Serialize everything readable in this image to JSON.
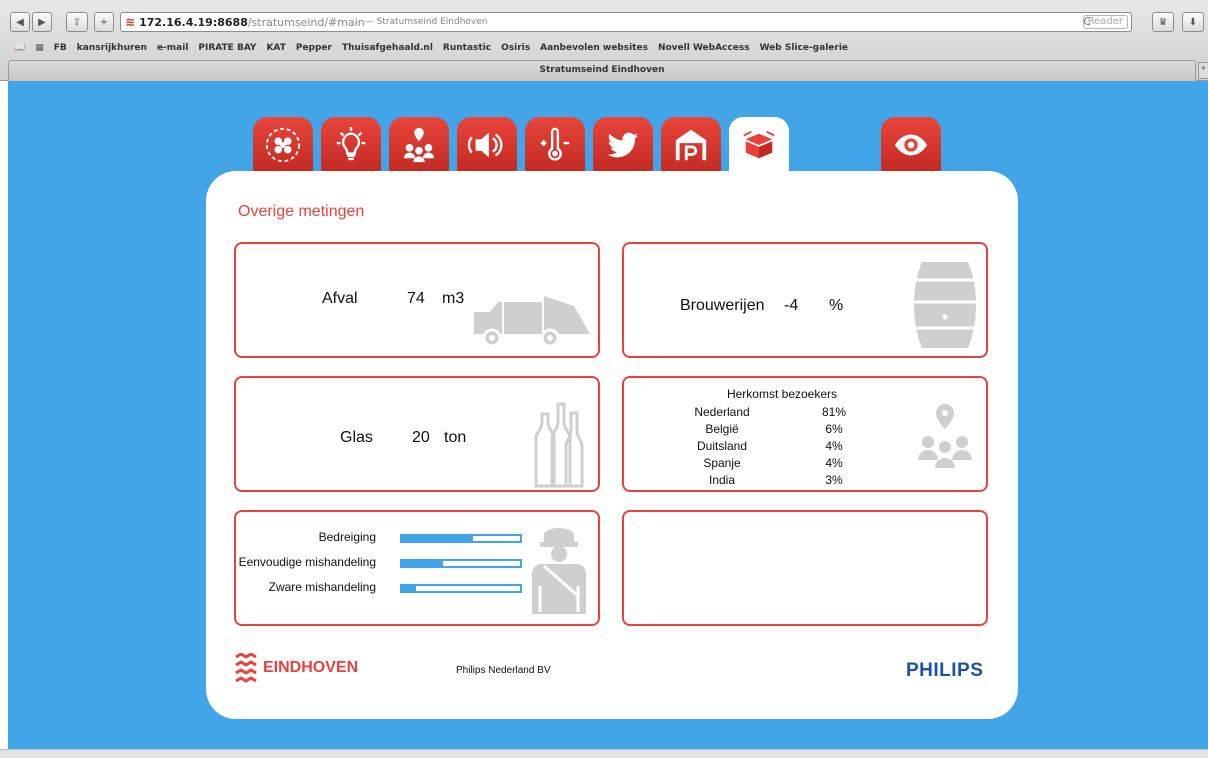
{
  "browser": {
    "back": "◀",
    "forward": "▶",
    "share": "⇪",
    "add": "+",
    "url_host": "172.16.4.19:8688",
    "url_path": "/stratumseind/#main",
    "url_title": " — Stratumseind Eindhoven",
    "reload": "C",
    "reader": "Reader",
    "bookmarks": [
      "FB",
      "kansrijkhuren",
      "e-mail",
      "PIRATE BAY",
      "KAT",
      "Pepper",
      "Thuisafgehaald.nl",
      "Runtastic",
      "Osiris",
      "Aanbevolen websites",
      "Novell WebAccess",
      "Web Slice-galerie"
    ],
    "tab_title": "Stratumseind Eindhoven",
    "new_tab": "+"
  },
  "nav": {
    "tabs": [
      {
        "icon": "people-icon",
        "active": false
      },
      {
        "icon": "lightbulb-icon",
        "active": false
      },
      {
        "icon": "visitors-location-icon",
        "active": false
      },
      {
        "icon": "sound-icon",
        "active": false
      },
      {
        "icon": "thermometer-icon",
        "active": false
      },
      {
        "icon": "twitter-icon",
        "active": false
      },
      {
        "icon": "parking-icon",
        "active": false
      },
      {
        "icon": "box-icon",
        "active": true
      },
      {
        "icon": "eye-icon",
        "active": false
      }
    ]
  },
  "section": {
    "title": "Overige metingen"
  },
  "afval": {
    "label": "Afval",
    "value": "74",
    "unit": "m3"
  },
  "brouwerijen": {
    "label": "Brouwerijen",
    "value": "-4",
    "unit": "%"
  },
  "glas": {
    "label": "Glas",
    "value": "20",
    "unit": "ton"
  },
  "herkomst": {
    "title": "Herkomst bezoekers",
    "rows": [
      {
        "country": "Nederland",
        "pct": "81%"
      },
      {
        "country": "België",
        "pct": "6%"
      },
      {
        "country": "Duitsland",
        "pct": "4%"
      },
      {
        "country": "Spanje",
        "pct": "4%"
      },
      {
        "country": "India",
        "pct": "3%"
      }
    ]
  },
  "crime": {
    "rows": [
      {
        "label": "Bedreiging",
        "level": 0.6
      },
      {
        "label": "Eenvoudige mishandeling",
        "level": 0.35
      },
      {
        "label": "Zware mishandeling",
        "level": 0.12
      }
    ]
  },
  "footer": {
    "logo_text": "EINDHOVEN",
    "credit": "Philips Nederland BV",
    "philips": "PHILIPS"
  },
  "colors": {
    "page_bg": "#41a5e8",
    "accent_red": "#e8423a",
    "philips_blue": "#1a53a6",
    "icon_grey": "#cccccc"
  }
}
